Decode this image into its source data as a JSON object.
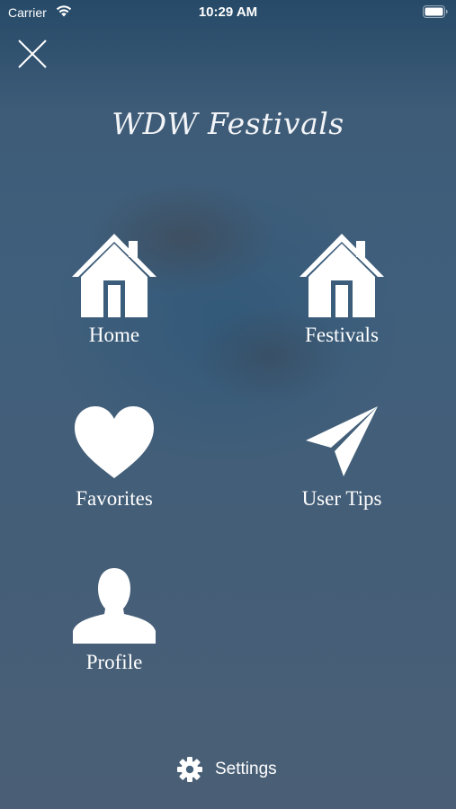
{
  "status_bar": {
    "carrier": "Carrier",
    "time": "10:29 AM",
    "wifi_icon": "wifi-icon",
    "battery_icon": "battery-full-icon"
  },
  "header": {
    "close_icon": "close-icon",
    "title": "WDW Festivals"
  },
  "menu": {
    "items": [
      {
        "label": "Home",
        "icon": "house-icon"
      },
      {
        "label": "Festivals",
        "icon": "house-icon"
      },
      {
        "label": "Favorites",
        "icon": "heart-icon"
      },
      {
        "label": "User Tips",
        "icon": "paper-plane-icon"
      },
      {
        "label": "Profile",
        "icon": "person-icon"
      }
    ]
  },
  "footer": {
    "settings_label": "Settings",
    "settings_icon": "gear-icon"
  },
  "colors": {
    "text": "#ffffff",
    "background_top": "#264a68",
    "background_bottom": "#4a5f76"
  }
}
